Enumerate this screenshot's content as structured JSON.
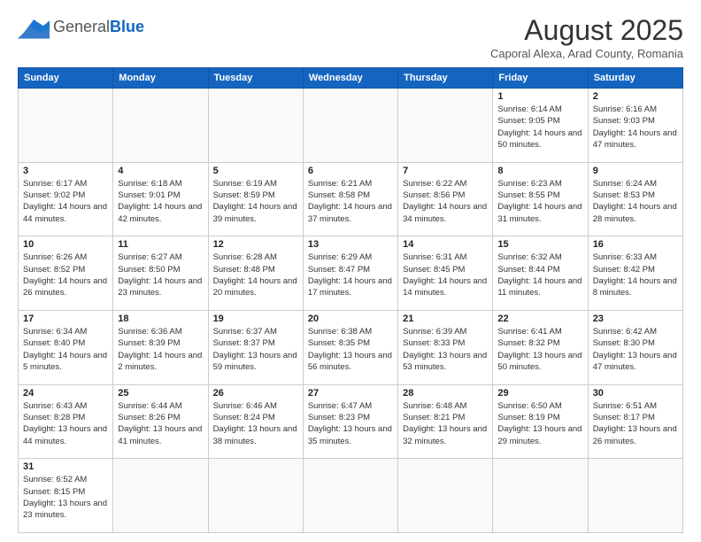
{
  "logo": {
    "general": "General",
    "blue": "Blue"
  },
  "header": {
    "month_title": "August 2025",
    "subtitle": "Caporal Alexa, Arad County, Romania"
  },
  "days_of_week": [
    "Sunday",
    "Monday",
    "Tuesday",
    "Wednesday",
    "Thursday",
    "Friday",
    "Saturday"
  ],
  "weeks": [
    [
      {
        "day": "",
        "info": ""
      },
      {
        "day": "",
        "info": ""
      },
      {
        "day": "",
        "info": ""
      },
      {
        "day": "",
        "info": ""
      },
      {
        "day": "",
        "info": ""
      },
      {
        "day": "1",
        "info": "Sunrise: 6:14 AM\nSunset: 9:05 PM\nDaylight: 14 hours and 50 minutes."
      },
      {
        "day": "2",
        "info": "Sunrise: 6:16 AM\nSunset: 9:03 PM\nDaylight: 14 hours and 47 minutes."
      }
    ],
    [
      {
        "day": "3",
        "info": "Sunrise: 6:17 AM\nSunset: 9:02 PM\nDaylight: 14 hours and 44 minutes."
      },
      {
        "day": "4",
        "info": "Sunrise: 6:18 AM\nSunset: 9:01 PM\nDaylight: 14 hours and 42 minutes."
      },
      {
        "day": "5",
        "info": "Sunrise: 6:19 AM\nSunset: 8:59 PM\nDaylight: 14 hours and 39 minutes."
      },
      {
        "day": "6",
        "info": "Sunrise: 6:21 AM\nSunset: 8:58 PM\nDaylight: 14 hours and 37 minutes."
      },
      {
        "day": "7",
        "info": "Sunrise: 6:22 AM\nSunset: 8:56 PM\nDaylight: 14 hours and 34 minutes."
      },
      {
        "day": "8",
        "info": "Sunrise: 6:23 AM\nSunset: 8:55 PM\nDaylight: 14 hours and 31 minutes."
      },
      {
        "day": "9",
        "info": "Sunrise: 6:24 AM\nSunset: 8:53 PM\nDaylight: 14 hours and 28 minutes."
      }
    ],
    [
      {
        "day": "10",
        "info": "Sunrise: 6:26 AM\nSunset: 8:52 PM\nDaylight: 14 hours and 26 minutes."
      },
      {
        "day": "11",
        "info": "Sunrise: 6:27 AM\nSunset: 8:50 PM\nDaylight: 14 hours and 23 minutes."
      },
      {
        "day": "12",
        "info": "Sunrise: 6:28 AM\nSunset: 8:48 PM\nDaylight: 14 hours and 20 minutes."
      },
      {
        "day": "13",
        "info": "Sunrise: 6:29 AM\nSunset: 8:47 PM\nDaylight: 14 hours and 17 minutes."
      },
      {
        "day": "14",
        "info": "Sunrise: 6:31 AM\nSunset: 8:45 PM\nDaylight: 14 hours and 14 minutes."
      },
      {
        "day": "15",
        "info": "Sunrise: 6:32 AM\nSunset: 8:44 PM\nDaylight: 14 hours and 11 minutes."
      },
      {
        "day": "16",
        "info": "Sunrise: 6:33 AM\nSunset: 8:42 PM\nDaylight: 14 hours and 8 minutes."
      }
    ],
    [
      {
        "day": "17",
        "info": "Sunrise: 6:34 AM\nSunset: 8:40 PM\nDaylight: 14 hours and 5 minutes."
      },
      {
        "day": "18",
        "info": "Sunrise: 6:36 AM\nSunset: 8:39 PM\nDaylight: 14 hours and 2 minutes."
      },
      {
        "day": "19",
        "info": "Sunrise: 6:37 AM\nSunset: 8:37 PM\nDaylight: 13 hours and 59 minutes."
      },
      {
        "day": "20",
        "info": "Sunrise: 6:38 AM\nSunset: 8:35 PM\nDaylight: 13 hours and 56 minutes."
      },
      {
        "day": "21",
        "info": "Sunrise: 6:39 AM\nSunset: 8:33 PM\nDaylight: 13 hours and 53 minutes."
      },
      {
        "day": "22",
        "info": "Sunrise: 6:41 AM\nSunset: 8:32 PM\nDaylight: 13 hours and 50 minutes."
      },
      {
        "day": "23",
        "info": "Sunrise: 6:42 AM\nSunset: 8:30 PM\nDaylight: 13 hours and 47 minutes."
      }
    ],
    [
      {
        "day": "24",
        "info": "Sunrise: 6:43 AM\nSunset: 8:28 PM\nDaylight: 13 hours and 44 minutes."
      },
      {
        "day": "25",
        "info": "Sunrise: 6:44 AM\nSunset: 8:26 PM\nDaylight: 13 hours and 41 minutes."
      },
      {
        "day": "26",
        "info": "Sunrise: 6:46 AM\nSunset: 8:24 PM\nDaylight: 13 hours and 38 minutes."
      },
      {
        "day": "27",
        "info": "Sunrise: 6:47 AM\nSunset: 8:23 PM\nDaylight: 13 hours and 35 minutes."
      },
      {
        "day": "28",
        "info": "Sunrise: 6:48 AM\nSunset: 8:21 PM\nDaylight: 13 hours and 32 minutes."
      },
      {
        "day": "29",
        "info": "Sunrise: 6:50 AM\nSunset: 8:19 PM\nDaylight: 13 hours and 29 minutes."
      },
      {
        "day": "30",
        "info": "Sunrise: 6:51 AM\nSunset: 8:17 PM\nDaylight: 13 hours and 26 minutes."
      }
    ],
    [
      {
        "day": "31",
        "info": "Sunrise: 6:52 AM\nSunset: 8:15 PM\nDaylight: 13 hours and 23 minutes."
      },
      {
        "day": "",
        "info": ""
      },
      {
        "day": "",
        "info": ""
      },
      {
        "day": "",
        "info": ""
      },
      {
        "day": "",
        "info": ""
      },
      {
        "day": "",
        "info": ""
      },
      {
        "day": "",
        "info": ""
      }
    ]
  ]
}
